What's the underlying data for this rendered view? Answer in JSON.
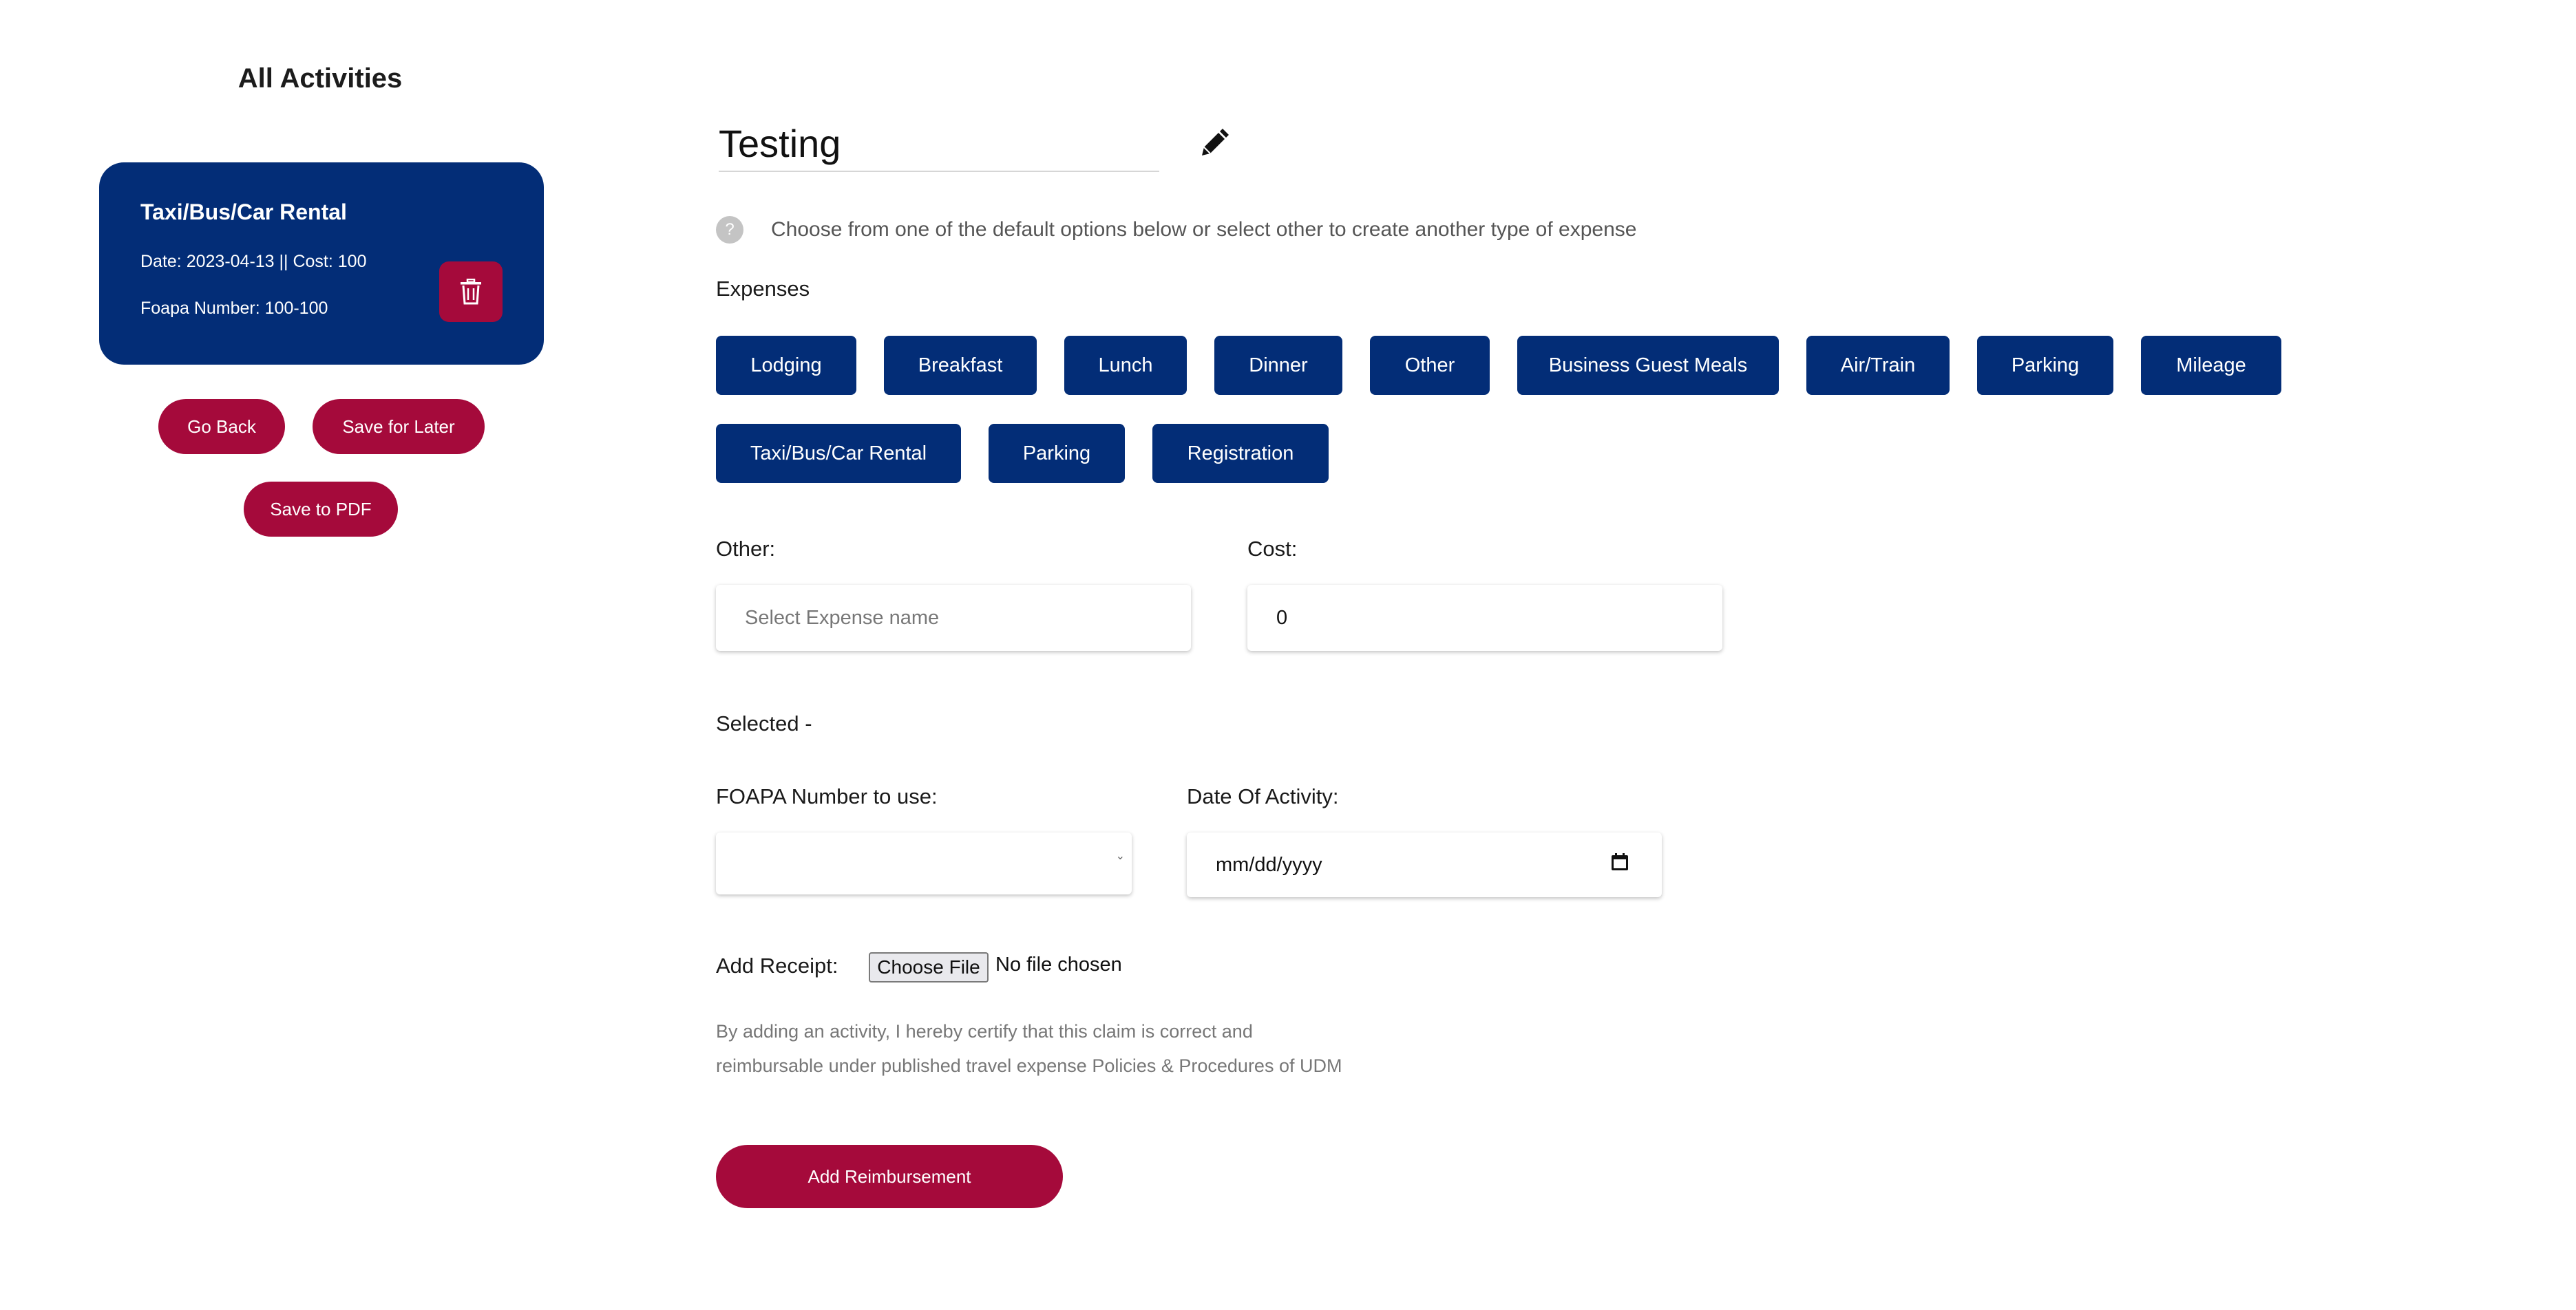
{
  "sidebar": {
    "title": "All Activities",
    "activity_card": {
      "title": "Taxi/Bus/Car Rental",
      "details": "Date: 2023-04-13 || Cost: 100",
      "foapa": "Foapa Number: 100-100"
    },
    "buttons": {
      "go_back": "Go Back",
      "save_later": "Save for Later",
      "save_pdf": "Save to PDF"
    }
  },
  "main": {
    "report_title": "Testing",
    "help_icon": "?",
    "help_text": "Choose from one of the default options below or select other to create another type of expense",
    "expenses_label": "Expenses",
    "expense_options": [
      "Lodging",
      "Breakfast",
      "Lunch",
      "Dinner",
      "Other",
      "Business Guest Meals",
      "Air/Train",
      "Parking",
      "Mileage",
      "Taxi/Bus/Car Rental",
      "Parking",
      "Registration"
    ],
    "other_label": "Other:",
    "other_placeholder": "Select Expense name",
    "cost_label": "Cost:",
    "cost_value": "0",
    "selected_text": "Selected -",
    "foapa_label": "FOAPA Number to use:",
    "date_label": "Date Of Activity:",
    "date_placeholder": "mm/dd/yyyy",
    "receipt_label": "Add Receipt:",
    "choose_file": "Choose File",
    "file_status": "No file chosen",
    "certify_line1": "By adding an activity, I hereby certify that this claim is correct and",
    "certify_line2": "reimbursable under published travel expense Policies & Procedures of UDM",
    "add_button": "Add Reimbursement"
  },
  "icons": {
    "delete": "trash-icon",
    "edit": "pencil-icon",
    "help": "question-icon",
    "calendar": "calendar-icon",
    "caret": "chevron-down-icon"
  },
  "colors": {
    "navy": "#032d77",
    "crimson": "#a50a3b"
  }
}
